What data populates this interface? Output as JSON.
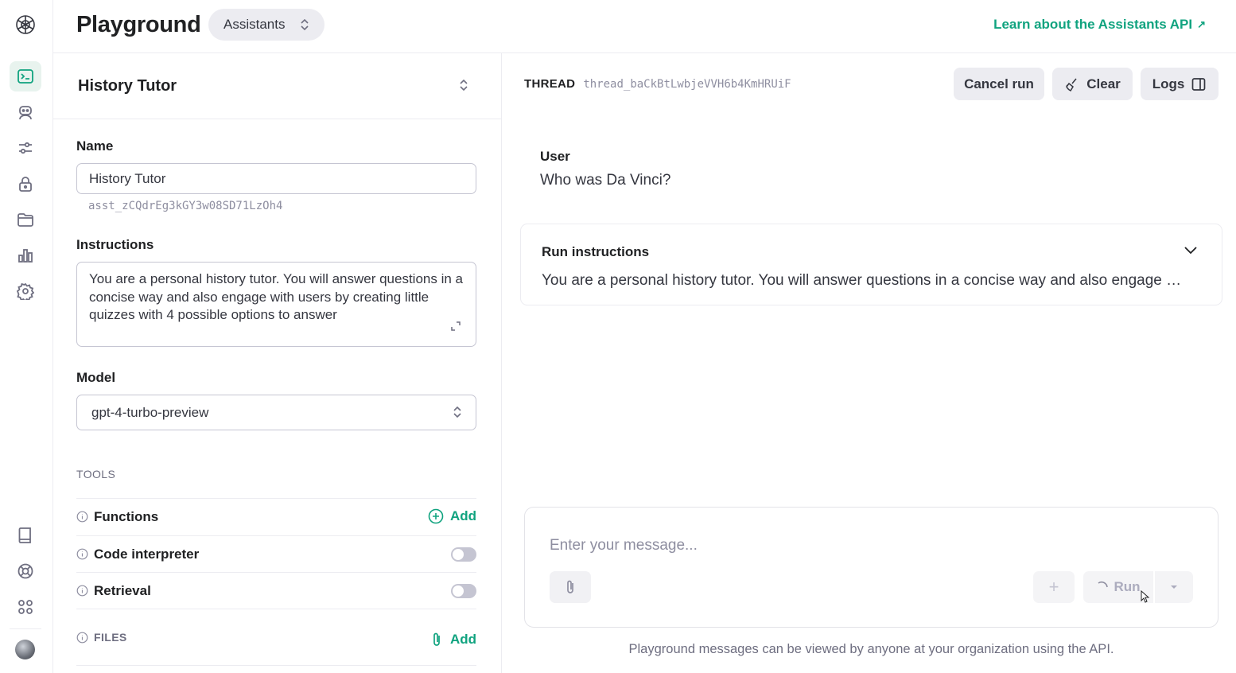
{
  "header": {
    "title": "Playground",
    "mode_selector": "Assistants",
    "learn_link": "Learn about the Assistants API",
    "learn_link_arrow": "↗"
  },
  "sidebar": {
    "items": [
      {
        "icon": "terminal-icon",
        "active": true
      },
      {
        "icon": "assistant-bot-icon"
      },
      {
        "icon": "sliders-icon"
      },
      {
        "icon": "lock-icon"
      },
      {
        "icon": "folder-icon"
      },
      {
        "icon": "bar-chart-icon"
      },
      {
        "icon": "gear-icon"
      }
    ],
    "bottom_items": [
      {
        "icon": "book-icon"
      },
      {
        "icon": "lifebuoy-icon"
      },
      {
        "icon": "apps-grid-icon"
      }
    ]
  },
  "assistant": {
    "selected_name": "History Tutor",
    "name_label": "Name",
    "name_value": "History Tutor",
    "assistant_id": "asst_zCQdrEg3kGY3w08SD71LzOh4",
    "instructions_label": "Instructions",
    "instructions_value": "You are a personal history tutor. You will answer questions in a concise way and also engage with users by creating little quizzes with 4 possible options to answer",
    "model_label": "Model",
    "model_value": "gpt-4-turbo-preview",
    "tools_heading": "TOOLS",
    "tools": {
      "functions": {
        "label": "Functions",
        "action": "Add"
      },
      "code_interpreter": {
        "label": "Code interpreter",
        "enabled": false
      },
      "retrieval": {
        "label": "Retrieval",
        "enabled": false
      }
    },
    "files": {
      "label": "FILES",
      "action": "Add"
    }
  },
  "thread": {
    "label": "THREAD",
    "id": "thread_baCkBtLwbjeVVH6b4KmHRUiF",
    "buttons": {
      "cancel_run": "Cancel run",
      "clear": "Clear",
      "logs": "Logs"
    },
    "messages": [
      {
        "role": "User",
        "text": "Who was Da Vinci?"
      }
    ],
    "run_instructions": {
      "title": "Run instructions",
      "text": "You are a personal history tutor. You will answer questions in a concise way and also engage …"
    }
  },
  "composer": {
    "placeholder": "Enter your message...",
    "plus_label": "+",
    "run_label": "Run"
  },
  "footnote": "Playground messages can be viewed by anyone at your organization using the API.",
  "colors": {
    "accent": "#10a37f",
    "border": "#ececf1",
    "button_bg": "#ececf1",
    "muted_text": "#8e8ea0"
  }
}
